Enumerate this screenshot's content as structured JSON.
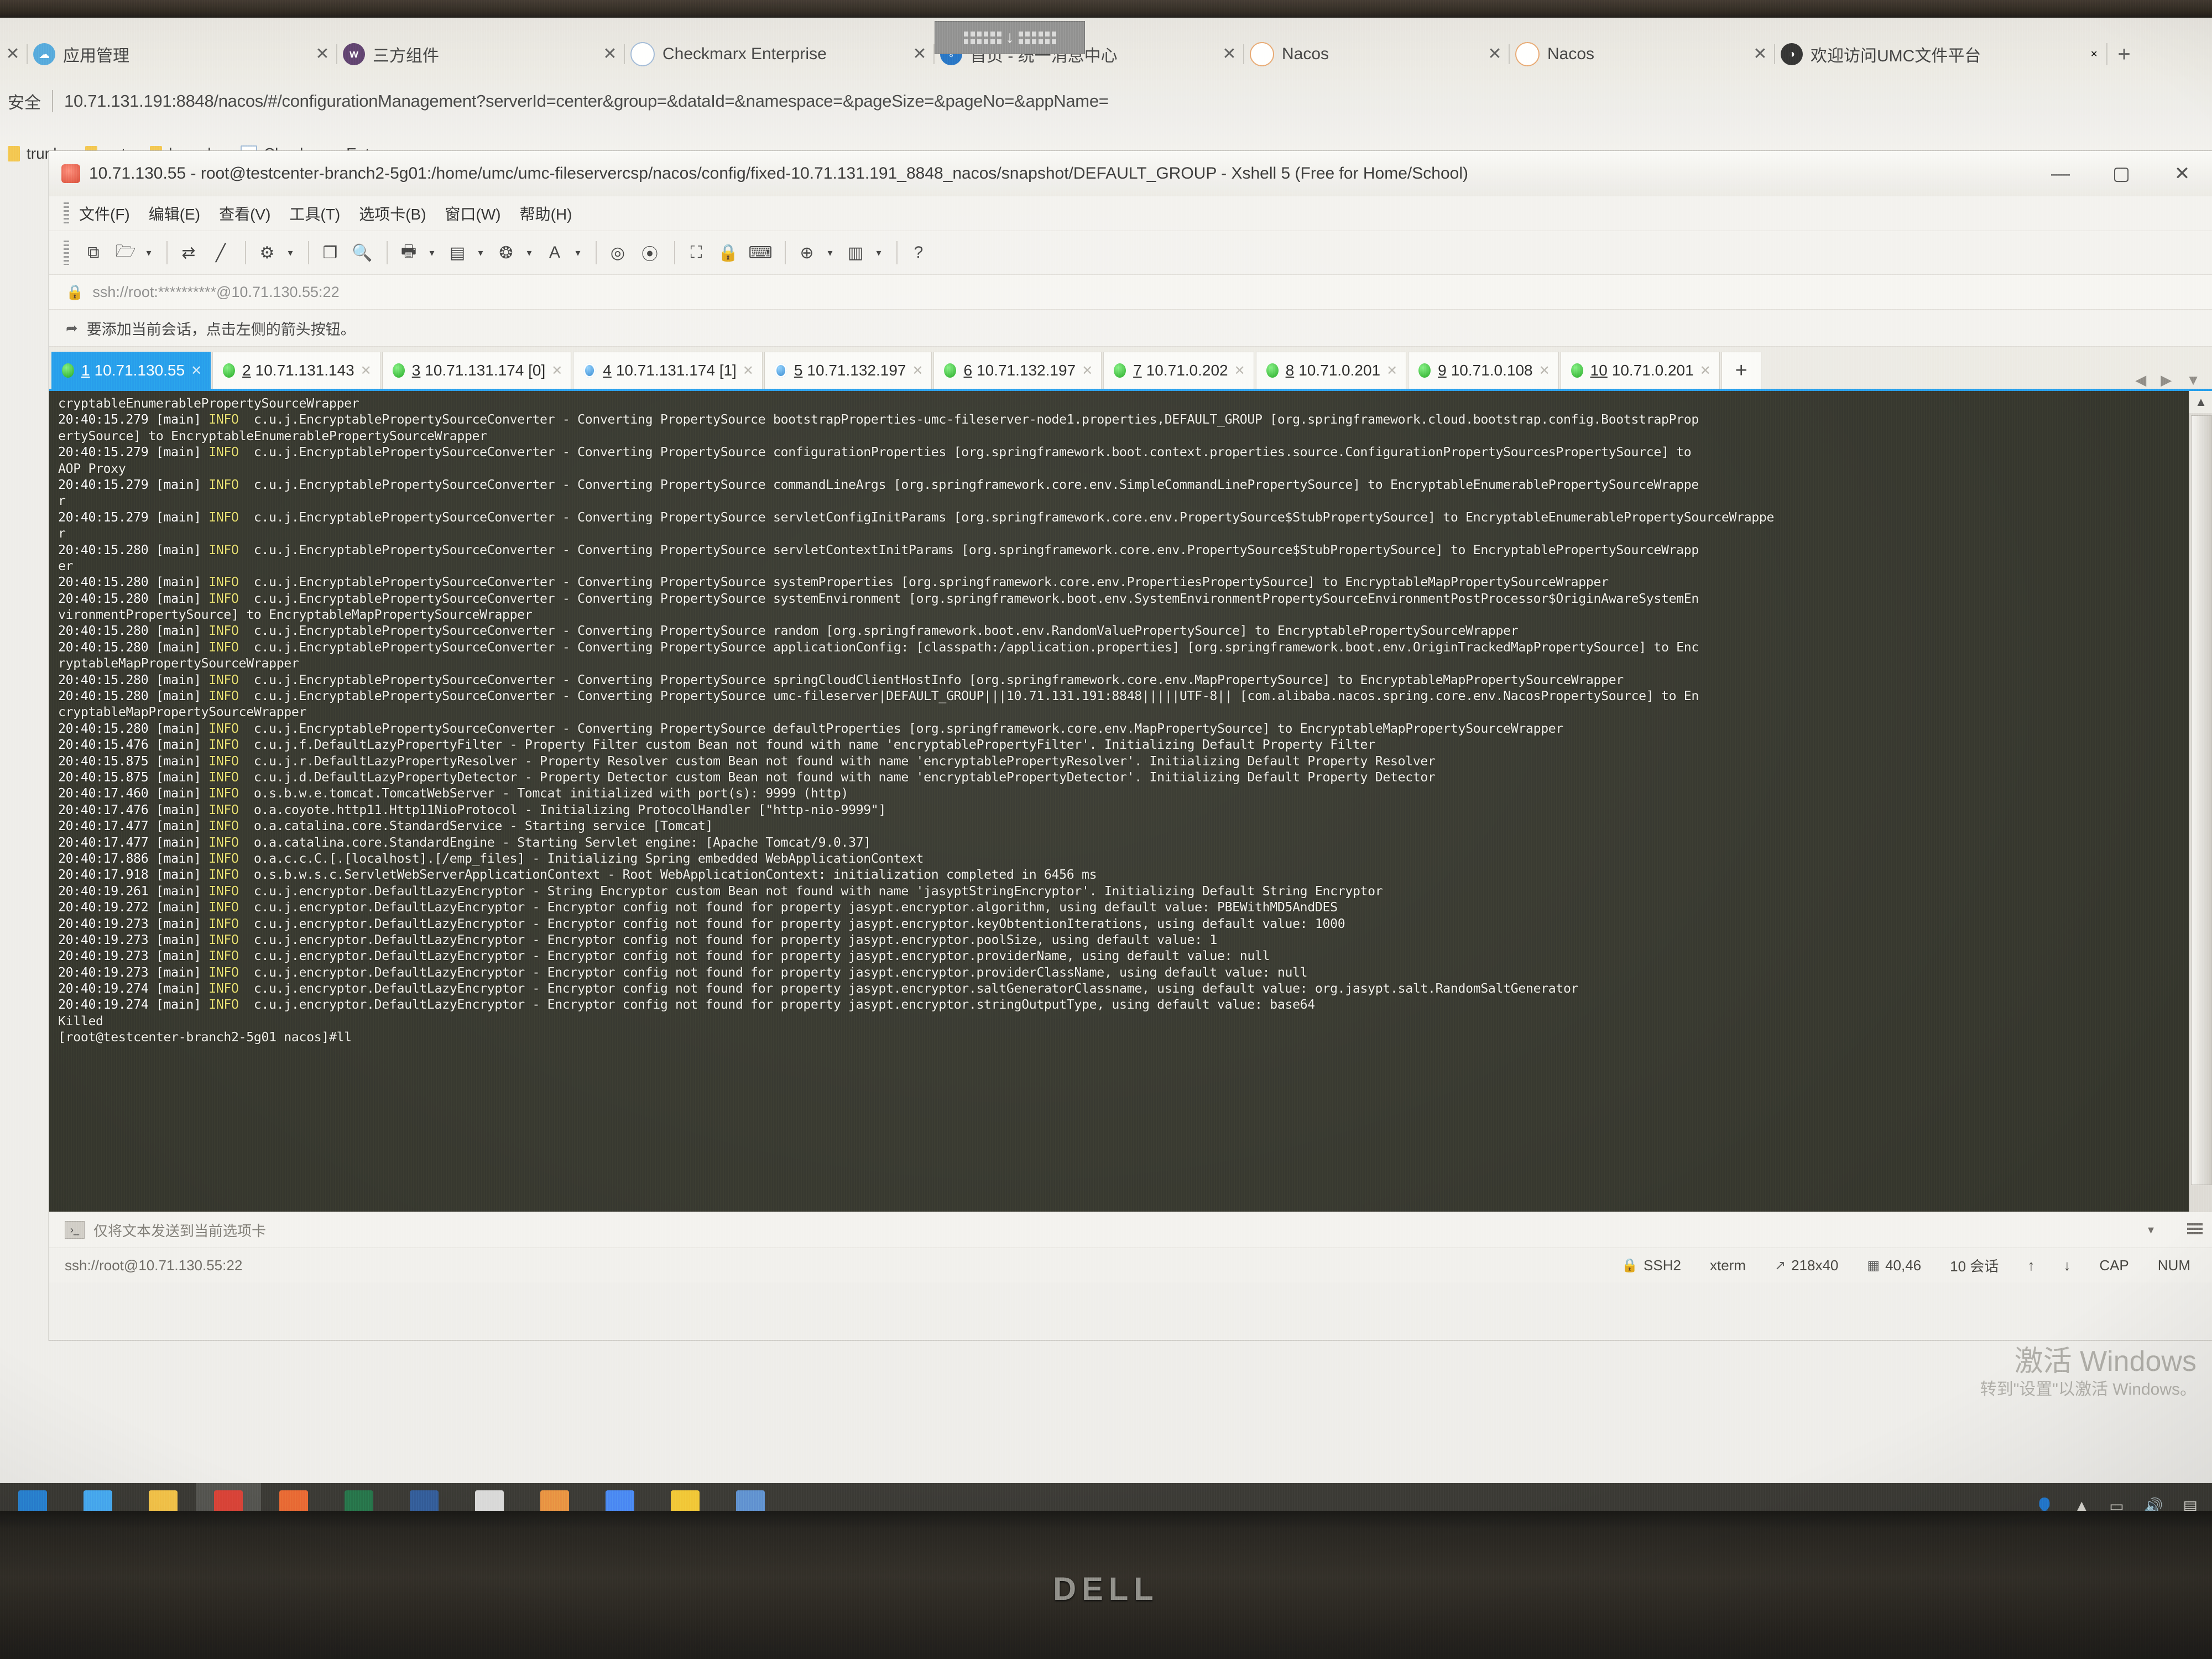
{
  "browser": {
    "tabs": [
      {
        "label": "应用管理",
        "favicon": "cloud-icon",
        "fav_class": "fav-blue",
        "close": "✕"
      },
      {
        "label": "三方组件",
        "favicon": "component-icon",
        "fav_class": "fav-purple",
        "close": "✕"
      },
      {
        "label": "Checkmarx Enterprise",
        "favicon": "checkmarx-icon",
        "fav_class": "fav-check",
        "close": "✕"
      },
      {
        "label": "首页 - 统一消息中心",
        "favicon": "globe-icon",
        "fav_class": "fav-globe",
        "close": "✕"
      },
      {
        "label": "Nacos",
        "favicon": "nacos-icon",
        "fav_class": "fav-nacos",
        "close": "✕"
      },
      {
        "label": "Nacos",
        "favicon": "nacos-icon",
        "fav_class": "fav-nacos",
        "close": "✕"
      },
      {
        "label": "欢迎访问UMC文件平台",
        "favicon": "umc-icon",
        "fav_class": "fav-dark",
        "close": "✕"
      }
    ],
    "new_tab_label": "+",
    "security_label": "安全",
    "url": "10.71.131.191:8848/nacos/#/configurationManagement?serverId=center&group=&dataId=&namespace=&pageSize=&pageNo=&appName=",
    "bookmarks": [
      {
        "label": "trunk",
        "icon": "folder-icon"
      },
      {
        "label": "pet",
        "icon": "folder-icon"
      },
      {
        "label": "branch",
        "icon": "folder-icon"
      },
      {
        "label": "Checkmarx Enter...",
        "icon": "checkmarx-icon"
      }
    ]
  },
  "xshell": {
    "title": "10.71.130.55 - root@testcenter-branch2-5g01:/home/umc/umc-fileservercsp/nacos/config/fixed-10.71.131.191_8848_nacos/snapshot/DEFAULT_GROUP - Xshell 5 (Free for Home/School)",
    "window_buttons": {
      "minimize": "—",
      "maximize": "▢",
      "close": "✕"
    },
    "menu": [
      "文件(F)",
      "编辑(E)",
      "查看(V)",
      "工具(T)",
      "选项卡(B)",
      "窗口(W)",
      "帮助(H)"
    ],
    "toolbar_icons": [
      "new-session-icon",
      "open-folder-icon",
      "folder-caret",
      "sep1",
      "transfer-icon",
      "disabled-icon",
      "sep2",
      "properties-icon",
      "properties-caret",
      "sep3",
      "copy-icon",
      "find-icon",
      "sep4",
      "log-icon",
      "log-caret",
      "layout-icon",
      "layout-caret",
      "compose-icon",
      "compose-caret",
      "font-icon",
      "font-caret",
      "sep5",
      "sftp-icon",
      "tunnel-icon",
      "sep6",
      "fullscreen-icon",
      "lock-icon",
      "keyboard-icon",
      "sep7",
      "add-icon",
      "add-caret",
      "columns-icon",
      "columns-caret",
      "sep8",
      "help-icon"
    ],
    "address": "ssh://root:**********@10.71.130.55:22",
    "address_lock_icon": "lock-icon",
    "hint": "要添加当前会话，点击左侧的箭头按钮。",
    "hint_icon": "add-session-icon",
    "session_tabs": [
      {
        "num": "1",
        "host": "10.71.130.55",
        "state": "green",
        "active": true
      },
      {
        "num": "2",
        "host": "10.71.131.143",
        "state": "green",
        "active": false
      },
      {
        "num": "3",
        "host": "10.71.131.174 [0]",
        "state": "green",
        "active": false
      },
      {
        "num": "4",
        "host": "10.71.131.174 [1]",
        "state": "blue",
        "active": false
      },
      {
        "num": "5",
        "host": "10.71.132.197",
        "state": "blue",
        "active": false
      },
      {
        "num": "6",
        "host": "10.71.132.197",
        "state": "green",
        "active": false
      },
      {
        "num": "7",
        "host": "10.71.0.202",
        "state": "green",
        "active": false
      },
      {
        "num": "8",
        "host": "10.71.0.201",
        "state": "green",
        "active": false
      },
      {
        "num": "9",
        "host": "10.71.0.108",
        "state": "green",
        "active": false
      },
      {
        "num": "10",
        "host": "10.71.0.201",
        "state": "green",
        "active": false
      }
    ],
    "session_tab_close": "✕",
    "session_tab_add": "+",
    "session_nav": [
      "◀",
      "▶",
      "▼"
    ],
    "terminal_lines": [
      "cryptableEnumerablePropertySourceWrapper",
      "20:40:15.279 [main] INFO  c.u.j.EncryptablePropertySourceConverter - Converting PropertySource bootstrapProperties-umc-fileserver-node1.properties,DEFAULT_GROUP [org.springframework.cloud.bootstrap.config.BootstrapProp",
      "ertySource] to EncryptableEnumerablePropertySourceWrapper",
      "20:40:15.279 [main] INFO  c.u.j.EncryptablePropertySourceConverter - Converting PropertySource configurationProperties [org.springframework.boot.context.properties.source.ConfigurationPropertySourcesPropertySource] to",
      "AOP Proxy",
      "20:40:15.279 [main] INFO  c.u.j.EncryptablePropertySourceConverter - Converting PropertySource commandLineArgs [org.springframework.core.env.SimpleCommandLinePropertySource] to EncryptableEnumerablePropertySourceWrappe",
      "r",
      "20:40:15.279 [main] INFO  c.u.j.EncryptablePropertySourceConverter - Converting PropertySource servletConfigInitParams [org.springframework.core.env.PropertySource$StubPropertySource] to EncryptableEnumerablePropertySourceWrappe",
      "r",
      "20:40:15.280 [main] INFO  c.u.j.EncryptablePropertySourceConverter - Converting PropertySource servletContextInitParams [org.springframework.core.env.PropertySource$StubPropertySource] to EncryptablePropertySourceWrapp",
      "er",
      "20:40:15.280 [main] INFO  c.u.j.EncryptablePropertySourceConverter - Converting PropertySource systemProperties [org.springframework.core.env.PropertiesPropertySource] to EncryptableMapPropertySourceWrapper",
      "20:40:15.280 [main] INFO  c.u.j.EncryptablePropertySourceConverter - Converting PropertySource systemEnvironment [org.springframework.boot.env.SystemEnvironmentPropertySourceEnvironmentPostProcessor$OriginAwareSystemEn",
      "vironmentPropertySource] to EncryptableMapPropertySourceWrapper",
      "20:40:15.280 [main] INFO  c.u.j.EncryptablePropertySourceConverter - Converting PropertySource random [org.springframework.boot.env.RandomValuePropertySource] to EncryptablePropertySourceWrapper",
      "20:40:15.280 [main] INFO  c.u.j.EncryptablePropertySourceConverter - Converting PropertySource applicationConfig: [classpath:/application.properties] [org.springframework.boot.env.OriginTrackedMapPropertySource] to Enc",
      "ryptableMapPropertySourceWrapper",
      "20:40:15.280 [main] INFO  c.u.j.EncryptablePropertySourceConverter - Converting PropertySource springCloudClientHostInfo [org.springframework.core.env.MapPropertySource] to EncryptableMapPropertySourceWrapper",
      "20:40:15.280 [main] INFO  c.u.j.EncryptablePropertySourceConverter - Converting PropertySource umc-fileserver|DEFAULT_GROUP|||10.71.131.191:8848|||||UTF-8|| [com.alibaba.nacos.spring.core.env.NacosPropertySource] to En",
      "cryptableMapPropertySourceWrapper",
      "20:40:15.280 [main] INFO  c.u.j.EncryptablePropertySourceConverter - Converting PropertySource defaultProperties [org.springframework.core.env.MapPropertySource] to EncryptableMapPropertySourceWrapper",
      "20:40:15.476 [main] INFO  c.u.j.f.DefaultLazyPropertyFilter - Property Filter custom Bean not found with name 'encryptablePropertyFilter'. Initializing Default Property Filter",
      "20:40:15.875 [main] INFO  c.u.j.r.DefaultLazyPropertyResolver - Property Resolver custom Bean not found with name 'encryptablePropertyResolver'. Initializing Default Property Resolver",
      "20:40:15.875 [main] INFO  c.u.j.d.DefaultLazyPropertyDetector - Property Detector custom Bean not found with name 'encryptablePropertyDetector'. Initializing Default Property Detector",
      "20:40:17.460 [main] INFO  o.s.b.w.e.tomcat.TomcatWebServer - Tomcat initialized with port(s): 9999 (http)",
      "20:40:17.476 [main] INFO  o.a.coyote.http11.Http11NioProtocol - Initializing ProtocolHandler [\"http-nio-9999\"]",
      "20:40:17.477 [main] INFO  o.a.catalina.core.StandardService - Starting service [Tomcat]",
      "20:40:17.477 [main] INFO  o.a.catalina.core.StandardEngine - Starting Servlet engine: [Apache Tomcat/9.0.37]",
      "20:40:17.886 [main] INFO  o.a.c.c.C.[.[localhost].[/emp_files] - Initializing Spring embedded WebApplicationContext",
      "20:40:17.918 [main] INFO  o.s.b.w.s.c.ServletWebServerApplicationContext - Root WebApplicationContext: initialization completed in 6456 ms",
      "20:40:19.261 [main] INFO  c.u.j.encryptor.DefaultLazyEncryptor - String Encryptor custom Bean not found with name 'jasyptStringEncryptor'. Initializing Default String Encryptor",
      "20:40:19.272 [main] INFO  c.u.j.encryptor.DefaultLazyEncryptor - Encryptor config not found for property jasypt.encryptor.algorithm, using default value: PBEWithMD5AndDES",
      "20:40:19.273 [main] INFO  c.u.j.encryptor.DefaultLazyEncryptor - Encryptor config not found for property jasypt.encryptor.keyObtentionIterations, using default value: 1000",
      "20:40:19.273 [main] INFO  c.u.j.encryptor.DefaultLazyEncryptor - Encryptor config not found for property jasypt.encryptor.poolSize, using default value: 1",
      "20:40:19.273 [main] INFO  c.u.j.encryptor.DefaultLazyEncryptor - Encryptor config not found for property jasypt.encryptor.providerName, using default value: null",
      "20:40:19.273 [main] INFO  c.u.j.encryptor.DefaultLazyEncryptor - Encryptor config not found for property jasypt.encryptor.providerClassName, using default value: null",
      "20:40:19.274 [main] INFO  c.u.j.encryptor.DefaultLazyEncryptor - Encryptor config not found for property jasypt.encryptor.saltGeneratorClassname, using default value: org.jasypt.salt.RandomSaltGenerator",
      "20:40:19.274 [main] INFO  c.u.j.encryptor.DefaultLazyEncryptor - Encryptor config not found for property jasypt.encryptor.stringOutputType, using default value: base64",
      "Killed",
      "[root@testcenter-branch2-5g01 nacos]#ll"
    ],
    "send_bar": {
      "label": "仅将文本发送到当前选项卡",
      "icon": "send-to-tab-icon"
    },
    "status": {
      "address": "ssh://root@10.71.130.55:22",
      "protocol": "SSH2",
      "protocol_icon": "lock-icon",
      "term_type": "xterm",
      "size": "218x40",
      "size_icon": "resize-icon",
      "cursor": "40,46",
      "cursor_icon": "cursor-icon",
      "sessions": "10 会话",
      "up_arrow": "↑",
      "down_arrow": "↓",
      "caps": "CAP",
      "num": "NUM"
    }
  },
  "watermark": {
    "line1": "激活 Windows",
    "line2": "转到\"设置\"以激活 Windows。"
  },
  "taskbar": {
    "items": [
      {
        "name": "start-button",
        "color": "#1f7fd4"
      },
      {
        "name": "task-view",
        "color": "#3fa9f5"
      },
      {
        "name": "file-explorer",
        "color": "#f5c242"
      },
      {
        "name": "pdf-reader",
        "color": "#d93b30"
      },
      {
        "name": "browser-alt",
        "color": "#e8642c"
      },
      {
        "name": "excel",
        "color": "#1d7044"
      },
      {
        "name": "word",
        "color": "#2b5797"
      },
      {
        "name": "cmd",
        "color": "#d8d8d8"
      },
      {
        "name": "paint",
        "color": "#e8913a"
      },
      {
        "name": "chrome",
        "color": "#4285f4"
      },
      {
        "name": "cloud-app",
        "color": "#f2c62e"
      },
      {
        "name": "xshell",
        "color": "#5a8fd0"
      }
    ],
    "tray": [
      "user-icon",
      "chevron-up-icon",
      "display-icon",
      "volume-icon",
      "network-icon"
    ]
  },
  "monitor": {
    "brand": "DELL"
  }
}
